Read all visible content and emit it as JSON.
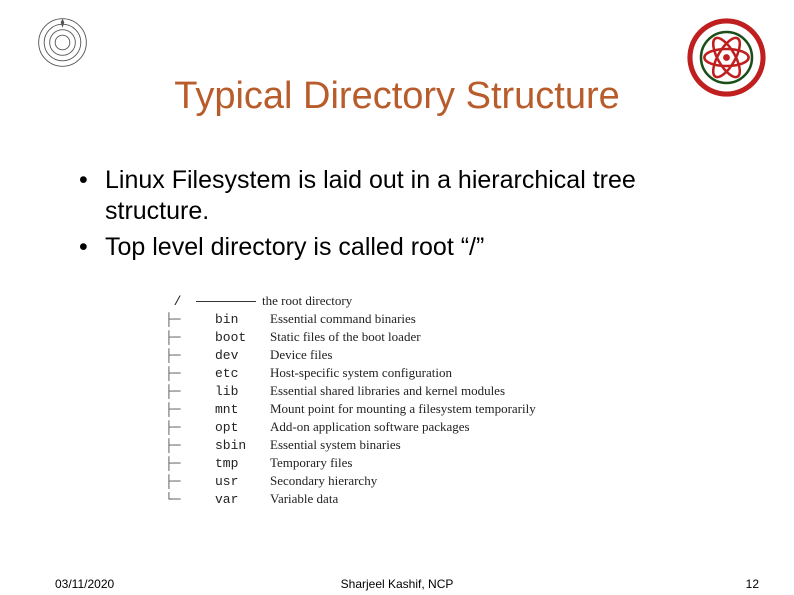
{
  "title": "Typical Directory Structure",
  "bullets": [
    "Linux Filesystem is laid out in a hierarchical tree structure.",
    "Top level directory is called root “/”"
  ],
  "tree": {
    "root_symbol": "/",
    "root_desc": "the root directory",
    "rows": [
      {
        "name": "bin",
        "desc": "Essential command binaries"
      },
      {
        "name": "boot",
        "desc": "Static files of the boot loader"
      },
      {
        "name": "dev",
        "desc": "Device files"
      },
      {
        "name": "etc",
        "desc": "Host-specific system configuration"
      },
      {
        "name": "lib",
        "desc": "Essential shared libraries and kernel modules"
      },
      {
        "name": "mnt",
        "desc": "Mount point for mounting a filesystem temporarily"
      },
      {
        "name": "opt",
        "desc": "Add-on application software packages"
      },
      {
        "name": "sbin",
        "desc": "Essential system binaries"
      },
      {
        "name": "tmp",
        "desc": "Temporary files"
      },
      {
        "name": "usr",
        "desc": "Secondary hierarchy"
      },
      {
        "name": "var",
        "desc": "Variable data"
      }
    ]
  },
  "footer": {
    "date": "03/11/2020",
    "author": "Sharjeel Kashif, NCP",
    "page": "12"
  },
  "logos": {
    "left_alt": "institution-logo",
    "right_alt": "ncp-logo"
  }
}
